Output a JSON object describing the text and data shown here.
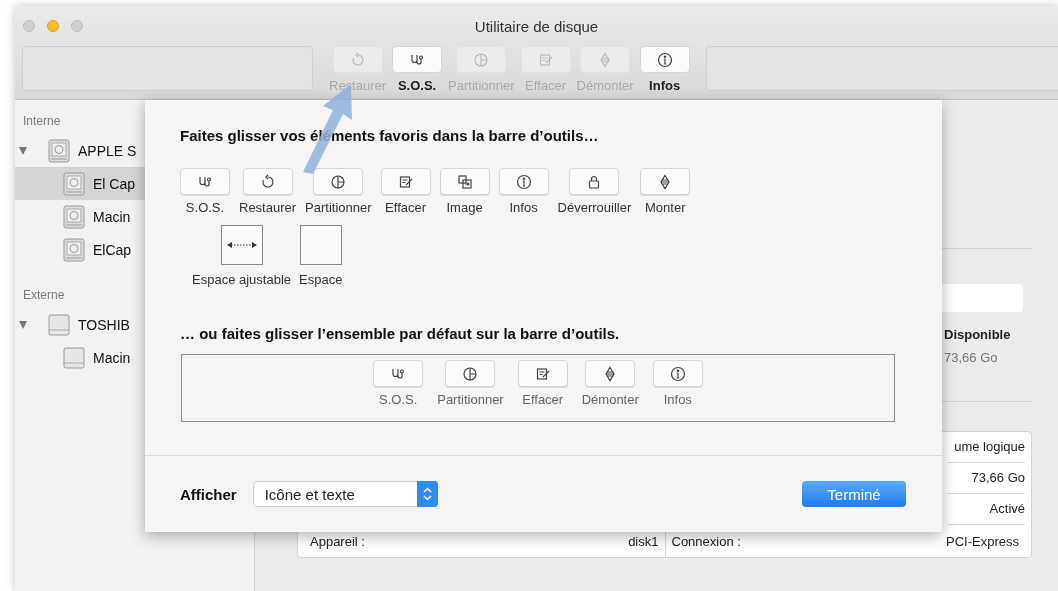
{
  "window": {
    "title": "Utilitaire de disque"
  },
  "toolbar": [
    {
      "label": "Restaurer",
      "disabled": true
    },
    {
      "label": "S.O.S.",
      "disabled": false
    },
    {
      "label": "Partitionner",
      "disabled": true
    },
    {
      "label": "Effacer",
      "disabled": true
    },
    {
      "label": "Démonter",
      "disabled": true
    },
    {
      "label": "Infos",
      "disabled": false
    }
  ],
  "sidebar": [
    {
      "label": "Interne",
      "items": [
        {
          "label": "APPLE S",
          "expanded": true,
          "selected": false,
          "children": [
            {
              "label": "El Cap",
              "selected": true
            },
            {
              "label": "Macin",
              "selected": false
            },
            {
              "label": "ElCap",
              "selected": false
            }
          ]
        }
      ]
    },
    {
      "label": "Externe",
      "items": [
        {
          "label": "TOSHIB",
          "expanded": true,
          "selected": false,
          "children": [
            {
              "label": "Macin",
              "selected": false
            }
          ]
        }
      ]
    }
  ],
  "details": {
    "available_label": "Disponible",
    "available_value": "73,66 Go",
    "table_rows": [
      {
        "cells": [
          "ume logique"
        ]
      },
      {
        "cells": [
          "73,66 Go"
        ]
      },
      {
        "cells": [
          "Activé"
        ]
      },
      {
        "cells": [
          "Appareil :",
          "disk1",
          "Connexion :",
          "PCI-Express"
        ]
      }
    ]
  },
  "sheet": {
    "title": "Faites glisser vos éléments favoris dans la barre d’outils…",
    "items": [
      {
        "label": "S.O.S.",
        "kind": "button"
      },
      {
        "label": "Restaurer",
        "kind": "button"
      },
      {
        "label": "Partitionner",
        "kind": "button"
      },
      {
        "label": "Effacer",
        "kind": "button"
      },
      {
        "label": "Image",
        "kind": "button"
      },
      {
        "label": "Infos",
        "kind": "button"
      },
      {
        "label": "Déverrouiller",
        "kind": "button"
      },
      {
        "label": "Monter",
        "kind": "button"
      },
      {
        "label": "Espace ajustable",
        "kind": "flexible-space"
      },
      {
        "label": "Espace",
        "kind": "space"
      }
    ],
    "default_title": "… ou faites glisser l’ensemble par défaut sur la barre d’outils.",
    "default_set": [
      {
        "label": "S.O.S."
      },
      {
        "label": "Partitionner"
      },
      {
        "label": "Effacer"
      },
      {
        "label": "Démonter"
      },
      {
        "label": "Infos"
      }
    ],
    "show_label": "Afficher",
    "show_value": "Icône et texte",
    "done_button": "Terminé"
  }
}
